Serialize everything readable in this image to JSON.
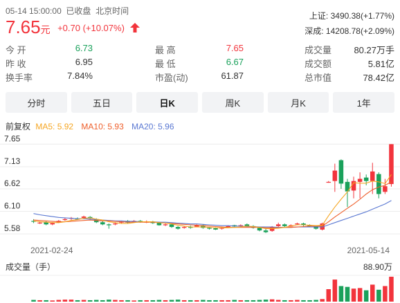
{
  "header": {
    "datetime": "05-14 15:00:00",
    "status": "已收盘",
    "timezone": "北京时间",
    "price": "7.65",
    "currency": "元",
    "change": "+0.70 (+10.07%)",
    "arrow": "up-arrow-icon"
  },
  "indices": [
    {
      "name": "上证:",
      "value": "3490.38(+1.77%)"
    },
    {
      "name": "深成:",
      "value": "14208.78(+2.09%)"
    }
  ],
  "stats": [
    [
      {
        "label": "今 开",
        "value": "6.73",
        "color": "green"
      },
      {
        "label": "最 高",
        "value": "7.65",
        "color": "red"
      },
      {
        "label": "成交量",
        "value": "80.27万手",
        "color": "none"
      }
    ],
    [
      {
        "label": "昨 收",
        "value": "6.95",
        "color": "none"
      },
      {
        "label": "最 低",
        "value": "6.67",
        "color": "green"
      },
      {
        "label": "成交额",
        "value": "5.81亿",
        "color": "none"
      }
    ],
    [
      {
        "label": "换手率",
        "value": "7.84%",
        "color": "none"
      },
      {
        "label": "市盈(动)",
        "value": "61.87",
        "color": "none"
      },
      {
        "label": "总市值",
        "value": "78.42亿",
        "color": "none"
      }
    ]
  ],
  "tabs": [
    {
      "label": "分时",
      "active": false
    },
    {
      "label": "五日",
      "active": false
    },
    {
      "label": "日K",
      "active": true
    },
    {
      "label": "周K",
      "active": false
    },
    {
      "label": "月K",
      "active": false
    },
    {
      "label": "1年",
      "active": false
    }
  ],
  "legend": {
    "adjust": "前复权",
    "ma5": "MA5: 5.92",
    "ma10": "MA10: 5.93",
    "ma20": "MA20: 5.96"
  },
  "colors": {
    "up": "#f2343c",
    "down": "#1aa15b",
    "ma5": "#f5a623",
    "ma10": "#ee5e2a",
    "ma20": "#5a78d2"
  },
  "chart_data": {
    "type": "candlestick",
    "y_ticks": [
      "7.65",
      "7.13",
      "6.62",
      "6.10",
      "5.58"
    ],
    "ylim": [
      5.55,
      7.72
    ],
    "x_start_label": "2021-02-24",
    "x_end_label": "2021-05-14",
    "volume_title": "成交量（手）",
    "volume_max_label": "88.90万",
    "candles": [
      [
        5.88,
        5.86,
        5.92,
        5.83
      ],
      [
        5.84,
        5.84,
        5.87,
        5.81
      ],
      [
        5.85,
        5.8,
        5.88,
        5.78
      ],
      [
        5.8,
        5.83,
        5.85,
        5.78
      ],
      [
        5.84,
        5.88,
        5.9,
        5.83
      ],
      [
        5.9,
        5.92,
        5.95,
        5.88
      ],
      [
        5.93,
        5.95,
        5.97,
        5.9
      ],
      [
        5.93,
        5.92,
        5.96,
        5.9
      ],
      [
        5.95,
        5.98,
        6.0,
        5.92
      ],
      [
        5.97,
        5.94,
        5.99,
        5.92
      ],
      [
        5.92,
        5.85,
        5.94,
        5.83
      ],
      [
        5.85,
        5.8,
        5.88,
        5.78
      ],
      [
        5.8,
        5.78,
        5.82,
        5.7
      ],
      [
        5.8,
        5.82,
        5.85,
        5.78
      ],
      [
        5.84,
        5.86,
        5.88,
        5.82
      ],
      [
        5.88,
        5.84,
        5.9,
        5.82
      ],
      [
        5.85,
        5.88,
        5.9,
        5.84
      ],
      [
        5.88,
        5.86,
        5.9,
        5.84
      ],
      [
        5.86,
        5.86,
        5.89,
        5.83
      ],
      [
        5.85,
        5.83,
        5.88,
        5.81
      ],
      [
        5.84,
        5.78,
        5.86,
        5.77
      ],
      [
        5.78,
        5.8,
        5.82,
        5.76
      ],
      [
        5.8,
        5.74,
        5.82,
        5.72
      ],
      [
        5.74,
        5.7,
        5.76,
        5.68
      ],
      [
        5.72,
        5.74,
        5.76,
        5.7
      ],
      [
        5.74,
        5.73,
        5.77,
        5.7
      ],
      [
        5.75,
        5.78,
        5.8,
        5.74
      ],
      [
        5.78,
        5.72,
        5.8,
        5.7
      ],
      [
        5.72,
        5.7,
        5.74,
        5.68
      ],
      [
        5.71,
        5.68,
        5.73,
        5.67
      ],
      [
        5.7,
        5.72,
        5.74,
        5.68
      ],
      [
        5.74,
        5.76,
        5.78,
        5.72
      ],
      [
        5.78,
        5.75,
        5.79,
        5.73
      ],
      [
        5.76,
        5.78,
        5.8,
        5.74
      ],
      [
        5.8,
        5.76,
        5.82,
        5.74
      ],
      [
        5.76,
        5.72,
        5.78,
        5.7
      ],
      [
        5.72,
        5.66,
        5.74,
        5.64
      ],
      [
        5.66,
        5.62,
        5.7,
        5.6
      ],
      [
        5.65,
        5.74,
        5.76,
        5.63
      ],
      [
        5.76,
        5.8,
        5.84,
        5.74
      ],
      [
        5.8,
        5.76,
        5.82,
        5.74
      ],
      [
        5.75,
        5.78,
        5.8,
        5.73
      ],
      [
        5.8,
        5.82,
        5.84,
        5.78
      ],
      [
        5.82,
        5.78,
        5.84,
        5.76
      ],
      [
        5.78,
        5.76,
        5.8,
        5.74
      ],
      [
        5.76,
        5.7,
        5.78,
        5.68
      ],
      [
        5.68,
        5.82,
        5.84,
        5.66
      ],
      [
        6.78,
        6.78,
        6.8,
        6.76
      ],
      [
        6.8,
        7.04,
        7.2,
        6.55
      ],
      [
        7.28,
        6.74,
        7.3,
        6.62
      ],
      [
        6.78,
        6.56,
        6.85,
        6.2
      ],
      [
        6.58,
        6.8,
        6.9,
        6.4
      ],
      [
        6.78,
        6.85,
        7.0,
        6.4
      ],
      [
        6.88,
        6.8,
        6.95,
        6.7
      ],
      [
        6.8,
        7.02,
        7.22,
        6.5
      ],
      [
        6.96,
        6.5,
        7.0,
        6.4
      ],
      [
        6.55,
        6.68,
        6.85,
        6.5
      ],
      [
        6.73,
        7.65,
        7.65,
        6.67
      ]
    ],
    "ma5": [
      5.88,
      5.86,
      5.85,
      5.84,
      5.84,
      5.86,
      5.89,
      5.91,
      5.94,
      5.95,
      5.92,
      5.9,
      5.86,
      5.84,
      5.82,
      5.82,
      5.84,
      5.86,
      5.86,
      5.86,
      5.84,
      5.83,
      5.81,
      5.78,
      5.76,
      5.74,
      5.74,
      5.74,
      5.73,
      5.72,
      5.72,
      5.72,
      5.73,
      5.74,
      5.76,
      5.75,
      5.73,
      5.7,
      5.7,
      5.71,
      5.73,
      5.76,
      5.79,
      5.79,
      5.78,
      5.77,
      5.78,
      6.0,
      6.2,
      6.38,
      6.55,
      6.76,
      6.75,
      6.75,
      6.8,
      6.78,
      6.74,
      6.95
    ],
    "ma10": [
      5.9,
      5.89,
      5.88,
      5.87,
      5.86,
      5.86,
      5.87,
      5.88,
      5.89,
      5.9,
      5.89,
      5.88,
      5.88,
      5.87,
      5.86,
      5.85,
      5.85,
      5.85,
      5.85,
      5.85,
      5.84,
      5.83,
      5.82,
      5.81,
      5.8,
      5.79,
      5.78,
      5.77,
      5.76,
      5.75,
      5.74,
      5.73,
      5.73,
      5.73,
      5.73,
      5.73,
      5.73,
      5.72,
      5.72,
      5.72,
      5.73,
      5.73,
      5.74,
      5.75,
      5.76,
      5.76,
      5.76,
      5.86,
      5.97,
      6.07,
      6.17,
      6.27,
      6.38,
      6.5,
      6.6,
      6.66,
      6.7,
      6.78
    ],
    "ma20": [
      6.05,
      6.02,
      6.0,
      5.98,
      5.96,
      5.95,
      5.94,
      5.93,
      5.93,
      5.92,
      5.91,
      5.9,
      5.89,
      5.88,
      5.88,
      5.87,
      5.87,
      5.86,
      5.86,
      5.86,
      5.85,
      5.85,
      5.84,
      5.83,
      5.82,
      5.81,
      5.81,
      5.8,
      5.79,
      5.78,
      5.77,
      5.77,
      5.76,
      5.76,
      5.75,
      5.75,
      5.74,
      5.74,
      5.74,
      5.73,
      5.73,
      5.73,
      5.74,
      5.74,
      5.74,
      5.74,
      5.74,
      5.79,
      5.84,
      5.89,
      5.94,
      5.99,
      6.04,
      6.09,
      6.15,
      6.21,
      6.27,
      6.35
    ],
    "volumes": [
      6,
      5,
      5,
      4,
      6,
      7,
      7,
      5,
      6,
      5,
      6,
      5,
      7,
      6,
      5,
      5,
      4,
      5,
      5,
      5,
      6,
      5,
      6,
      7,
      5,
      5,
      5,
      6,
      5,
      5,
      5,
      5,
      6,
      5,
      5,
      5,
      6,
      7,
      8,
      6,
      5,
      5,
      6,
      5,
      5,
      6,
      9,
      44,
      78,
      55,
      52,
      46,
      48,
      40,
      60,
      42,
      55,
      88
    ]
  }
}
